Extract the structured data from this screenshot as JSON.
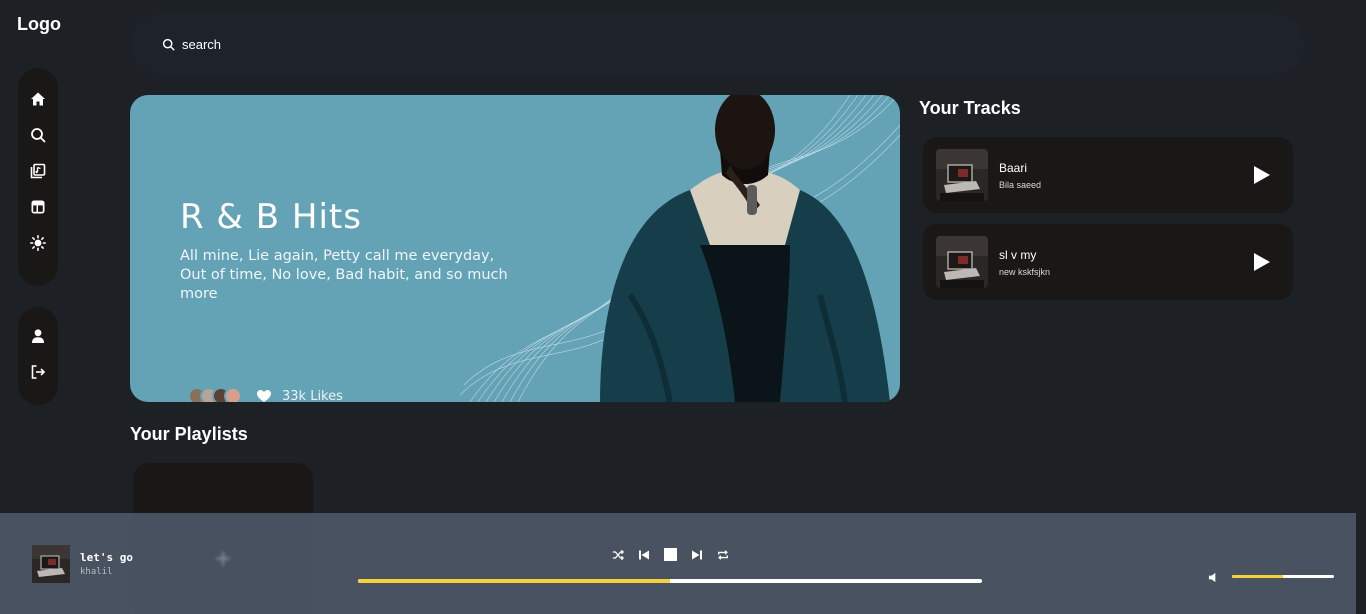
{
  "app": {
    "logo": "Logo"
  },
  "sidebar": {
    "top_icons": [
      "home-icon",
      "search-icon",
      "library-icon",
      "layout-icon",
      "sun-icon"
    ],
    "bottom_icons": [
      "user-icon",
      "logout-icon"
    ]
  },
  "search": {
    "placeholder": "search"
  },
  "hero": {
    "title": "R & B Hits",
    "description": "All mine, Lie again, Petty call me everyday, Out of time, No love, Bad habit, and so much more",
    "likes": "33k Likes"
  },
  "tracks": {
    "title": "Your Tracks",
    "items": [
      {
        "name": "Baari",
        "artist": "Bila saeed"
      },
      {
        "name": "sl v my",
        "artist": "new kskfsjkn"
      }
    ]
  },
  "playlists": {
    "title": "Your Playlists"
  },
  "player": {
    "song": "let's go",
    "artist": "khalil",
    "progress_fraction": 0.5,
    "volume_fraction": 0.5
  },
  "colors": {
    "background": "#1d2025",
    "hero": "#64a2b5",
    "card": "#1a1816",
    "player_bar": "#4c5666",
    "accent": "#f6d23a"
  }
}
